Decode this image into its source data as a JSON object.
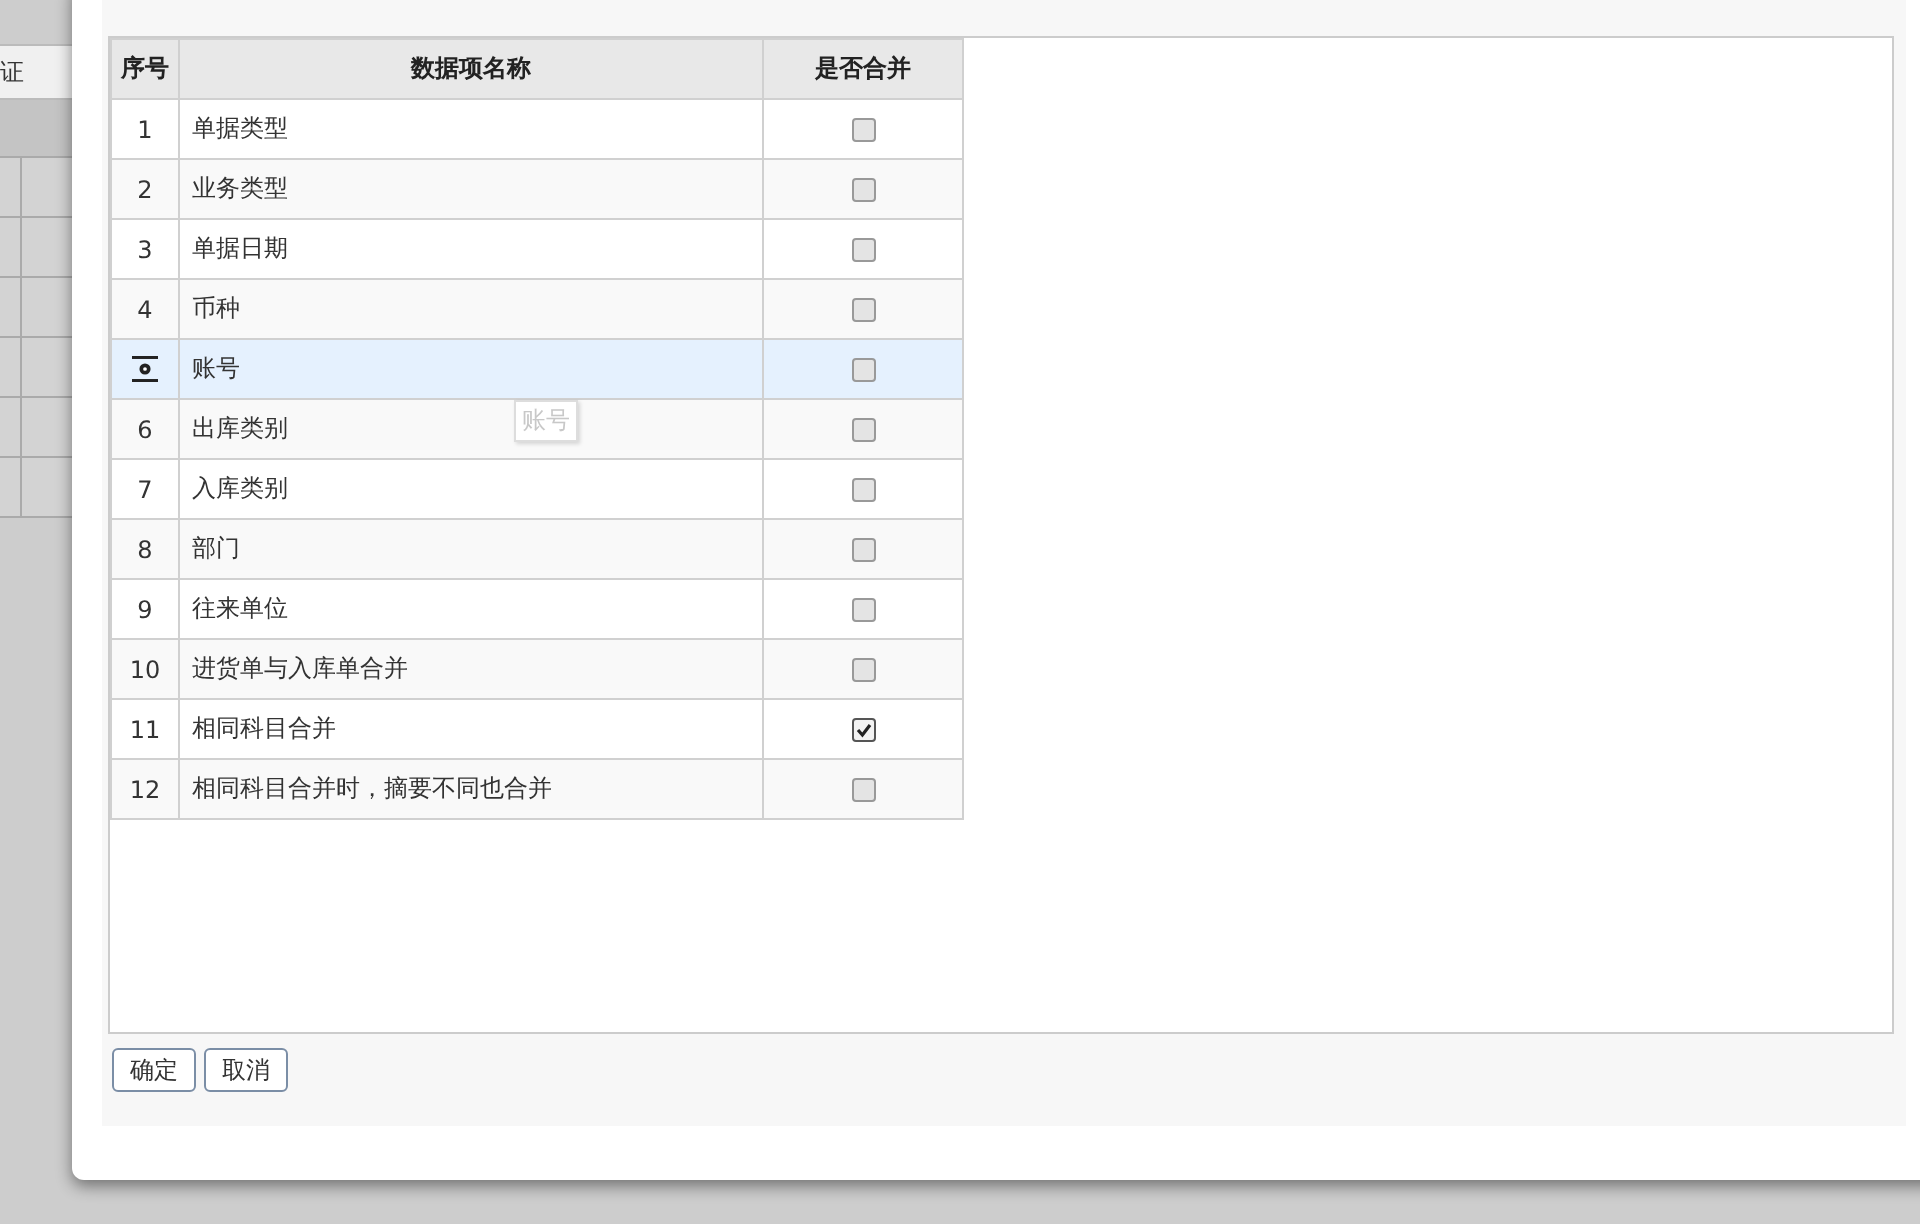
{
  "background": {
    "tab_label": "证"
  },
  "table": {
    "columns": [
      "序号",
      "数据项名称",
      "是否合并"
    ],
    "rows": [
      {
        "index": "1",
        "name": "单据类型",
        "checked": false,
        "selected": false,
        "kind": "normal"
      },
      {
        "index": "2",
        "name": "业务类型",
        "checked": false,
        "selected": false,
        "kind": "normal"
      },
      {
        "index": "3",
        "name": "单据日期",
        "checked": false,
        "selected": false,
        "kind": "normal"
      },
      {
        "index": "4",
        "name": "币种",
        "checked": false,
        "selected": false,
        "kind": "normal"
      },
      {
        "name": "账号",
        "checked": false,
        "selected": true,
        "kind": "drag"
      },
      {
        "index": "6",
        "name": "出库类别",
        "checked": false,
        "selected": false,
        "kind": "normal"
      },
      {
        "index": "7",
        "name": "入库类别",
        "checked": false,
        "selected": false,
        "kind": "normal"
      },
      {
        "index": "8",
        "name": "部门",
        "checked": false,
        "selected": false,
        "kind": "normal"
      },
      {
        "index": "9",
        "name": "往来单位",
        "checked": false,
        "selected": false,
        "kind": "normal"
      },
      {
        "index": "10",
        "name": "进货单与入库单合并",
        "checked": false,
        "selected": false,
        "kind": "normal"
      },
      {
        "index": "11",
        "name": "相同科目合并",
        "checked": true,
        "selected": false,
        "kind": "normal"
      },
      {
        "index": "12",
        "name": "相同科目合并时，摘要不同也合并",
        "checked": false,
        "selected": false,
        "kind": "normal"
      }
    ]
  },
  "drag_ghost": {
    "label": "账号"
  },
  "buttons": [
    "确定",
    "取消"
  ]
}
